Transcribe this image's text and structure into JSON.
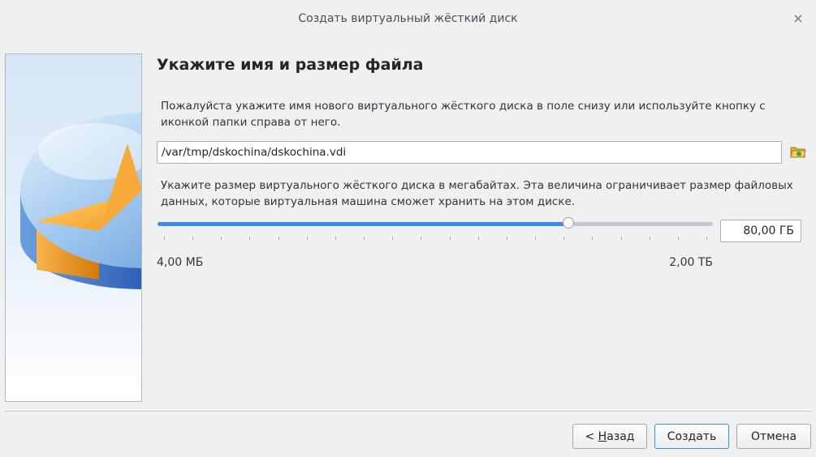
{
  "window": {
    "title": "Создать виртуальный жёсткий диск",
    "close_symbol": "×"
  },
  "side_image": {
    "icon": "hard-disk-pie-chart-icon",
    "colors": {
      "disk_blue": "#2f5fb8",
      "disk_light": "#9cc6ee",
      "slice_orange": "#f59a1b"
    }
  },
  "page": {
    "heading": "Укажите имя и размер файла",
    "file_description": "Пожалуйста укажите имя нового виртуального жёсткого диска в поле снизу или используйте кнопку с иконкой папки справа от него.",
    "file_path": "/var/tmp/dskochina/dskochina.vdi",
    "folder_button_icon": "folder-open-icon",
    "size_description": "Укажите размер виртуального жёсткого диска в мегабайтах. Эта величина ограничивает размер файловых данных, которые виртуальная машина сможет хранить на этом диске.",
    "size_value": "80,00 ГБ",
    "slider_fraction": 0.74,
    "range_min": "4,00 МБ",
    "range_max": "2,00 ТБ",
    "accent_color": "#3d8ee0"
  },
  "buttons": {
    "back_prefix": "< ",
    "back_mnemonic": "Н",
    "back_rest": "азад",
    "create": "Создать",
    "cancel": "Отмена"
  }
}
